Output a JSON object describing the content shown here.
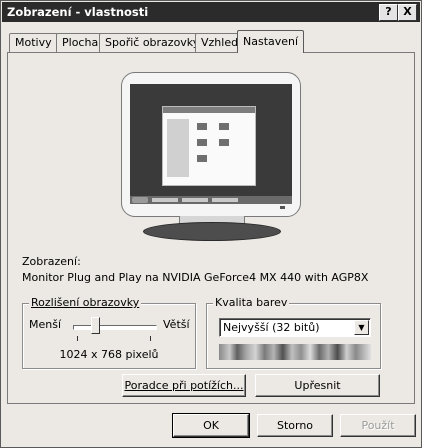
{
  "window": {
    "title": "Zobrazení - vlastnosti",
    "help_label": "?",
    "close_label": "X"
  },
  "tabs": [
    {
      "label": "Motivy"
    },
    {
      "label": "Plocha"
    },
    {
      "label": "Spořič obrazovky"
    },
    {
      "label": "Vzhled"
    },
    {
      "label": "Nastavení",
      "active": true
    }
  ],
  "display": {
    "label": "Zobrazení:",
    "value": "Monitor Plug and Play na NVIDIA GeForce4 MX 440 with AGP8X"
  },
  "resolution": {
    "title": "Rozlišení obrazovky",
    "less_label": "Menší",
    "more_label": "Větší",
    "value": "1024 x 768 pixelů",
    "slider_level": 0.25
  },
  "color_quality": {
    "title": "Kvalita barev",
    "selected": "Nejvyšší (32 bitů)"
  },
  "buttons": {
    "troubleshoot": "Poradce při potížích...",
    "advanced": "Upřesnit",
    "ok": "OK",
    "cancel": "Storno",
    "apply": "Použít"
  }
}
